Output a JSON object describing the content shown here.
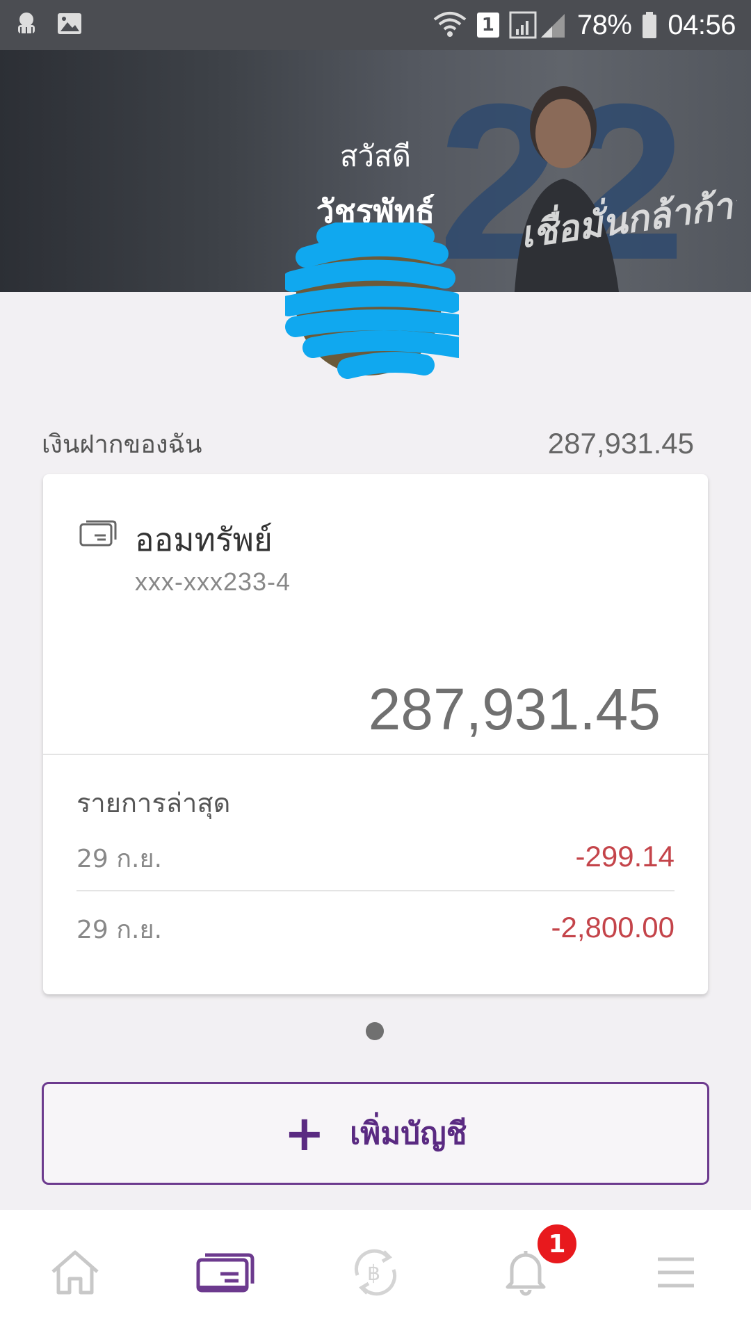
{
  "status_bar": {
    "battery": "78%",
    "time": "04:56",
    "sim_slot": "1"
  },
  "header": {
    "greeting": "สวัสดี",
    "user_name": "วัชรพัทธ์",
    "banner_number": "22",
    "banner_slogan": "เชื่อมั่นกล้าก้าว"
  },
  "deposits": {
    "label": "เงินฝากของฉัน",
    "total": "287,931.45"
  },
  "account_card": {
    "account_name": "ออมทรัพย์",
    "account_number": "xxx-xxx233-4",
    "balance": "287,931.45",
    "recent_title": "รายการล่าสุด",
    "transactions": [
      {
        "date": "29 ก.ย.",
        "amount": "-299.14"
      },
      {
        "date": "29 ก.ย.",
        "amount": "-2,800.00"
      }
    ]
  },
  "add_account": {
    "label": "เพิ่มบัญชี"
  },
  "bottom_nav": {
    "items": [
      {
        "icon": "home-icon",
        "active": false
      },
      {
        "icon": "accounts-card-icon",
        "active": true
      },
      {
        "icon": "transfer-baht-icon",
        "active": false
      },
      {
        "icon": "notification-bell-icon",
        "active": false
      },
      {
        "icon": "menu-icon",
        "active": false
      }
    ],
    "notification_count": "1"
  },
  "colors": {
    "accent": "#5a2a82",
    "negative": "#c4444a",
    "badge": "#e8191d"
  }
}
